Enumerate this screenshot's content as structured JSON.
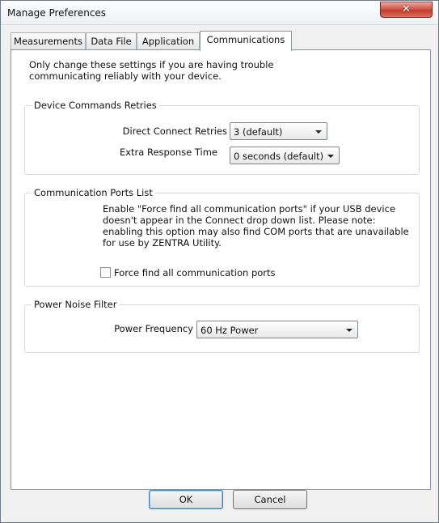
{
  "window": {
    "title": "Manage Preferences",
    "close_label": "✕"
  },
  "tabs": [
    {
      "label": "Measurements",
      "selected": false
    },
    {
      "label": "Data File",
      "selected": false
    },
    {
      "label": "Application",
      "selected": false
    },
    {
      "label": "Communications",
      "selected": true
    }
  ],
  "intro_text": "Only change these settings if you are having trouble communicating reliably with your device.",
  "device_retries": {
    "title": "Device Commands Retries",
    "direct_connect_label": "Direct Connect Retries",
    "direct_connect_value": "3 (default)",
    "extra_response_label": "Extra Response Time",
    "extra_response_value": "0 seconds (default)"
  },
  "ports": {
    "title": "Communication Ports List",
    "help_text": "Enable \"Force find all communication ports\" if your USB device doesn't appear in the Connect drop down list. Please note: enabling this option may also find COM ports that are unavailable for use by ZENTRA Utility.",
    "checkbox_label": "Force find all communication ports",
    "checkbox_checked": false
  },
  "power": {
    "title": "Power Noise Filter",
    "frequency_label": "Power Frequency",
    "frequency_value": "60 Hz Power"
  },
  "buttons": {
    "ok_label": "OK",
    "cancel_label": "Cancel"
  }
}
